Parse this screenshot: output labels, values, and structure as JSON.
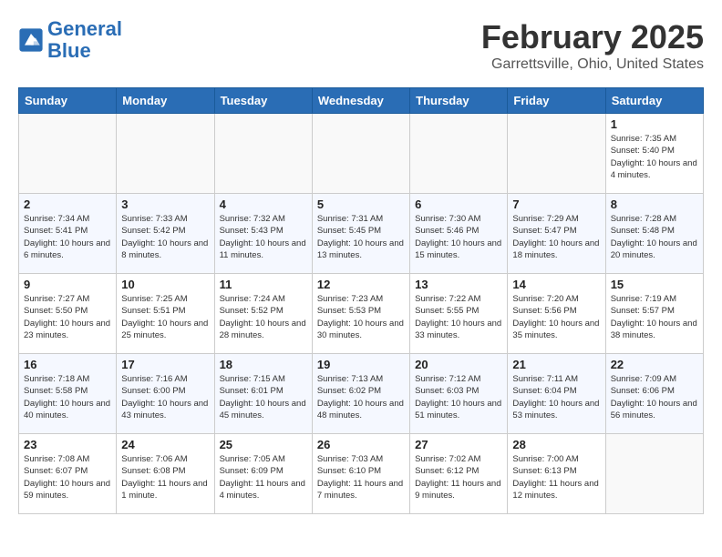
{
  "header": {
    "logo_line1": "General",
    "logo_line2": "Blue",
    "month_title": "February 2025",
    "subtitle": "Garrettsville, Ohio, United States"
  },
  "days_of_week": [
    "Sunday",
    "Monday",
    "Tuesday",
    "Wednesday",
    "Thursday",
    "Friday",
    "Saturday"
  ],
  "weeks": [
    [
      {
        "num": "",
        "info": "",
        "empty": true
      },
      {
        "num": "",
        "info": "",
        "empty": true
      },
      {
        "num": "",
        "info": "",
        "empty": true
      },
      {
        "num": "",
        "info": "",
        "empty": true
      },
      {
        "num": "",
        "info": "",
        "empty": true
      },
      {
        "num": "",
        "info": "",
        "empty": true
      },
      {
        "num": "1",
        "info": "Sunrise: 7:35 AM\nSunset: 5:40 PM\nDaylight: 10 hours\nand 4 minutes.",
        "empty": false
      }
    ],
    [
      {
        "num": "2",
        "info": "Sunrise: 7:34 AM\nSunset: 5:41 PM\nDaylight: 10 hours\nand 6 minutes.",
        "empty": false
      },
      {
        "num": "3",
        "info": "Sunrise: 7:33 AM\nSunset: 5:42 PM\nDaylight: 10 hours\nand 8 minutes.",
        "empty": false
      },
      {
        "num": "4",
        "info": "Sunrise: 7:32 AM\nSunset: 5:43 PM\nDaylight: 10 hours\nand 11 minutes.",
        "empty": false
      },
      {
        "num": "5",
        "info": "Sunrise: 7:31 AM\nSunset: 5:45 PM\nDaylight: 10 hours\nand 13 minutes.",
        "empty": false
      },
      {
        "num": "6",
        "info": "Sunrise: 7:30 AM\nSunset: 5:46 PM\nDaylight: 10 hours\nand 15 minutes.",
        "empty": false
      },
      {
        "num": "7",
        "info": "Sunrise: 7:29 AM\nSunset: 5:47 PM\nDaylight: 10 hours\nand 18 minutes.",
        "empty": false
      },
      {
        "num": "8",
        "info": "Sunrise: 7:28 AM\nSunset: 5:48 PM\nDaylight: 10 hours\nand 20 minutes.",
        "empty": false
      }
    ],
    [
      {
        "num": "9",
        "info": "Sunrise: 7:27 AM\nSunset: 5:50 PM\nDaylight: 10 hours\nand 23 minutes.",
        "empty": false
      },
      {
        "num": "10",
        "info": "Sunrise: 7:25 AM\nSunset: 5:51 PM\nDaylight: 10 hours\nand 25 minutes.",
        "empty": false
      },
      {
        "num": "11",
        "info": "Sunrise: 7:24 AM\nSunset: 5:52 PM\nDaylight: 10 hours\nand 28 minutes.",
        "empty": false
      },
      {
        "num": "12",
        "info": "Sunrise: 7:23 AM\nSunset: 5:53 PM\nDaylight: 10 hours\nand 30 minutes.",
        "empty": false
      },
      {
        "num": "13",
        "info": "Sunrise: 7:22 AM\nSunset: 5:55 PM\nDaylight: 10 hours\nand 33 minutes.",
        "empty": false
      },
      {
        "num": "14",
        "info": "Sunrise: 7:20 AM\nSunset: 5:56 PM\nDaylight: 10 hours\nand 35 minutes.",
        "empty": false
      },
      {
        "num": "15",
        "info": "Sunrise: 7:19 AM\nSunset: 5:57 PM\nDaylight: 10 hours\nand 38 minutes.",
        "empty": false
      }
    ],
    [
      {
        "num": "16",
        "info": "Sunrise: 7:18 AM\nSunset: 5:58 PM\nDaylight: 10 hours\nand 40 minutes.",
        "empty": false
      },
      {
        "num": "17",
        "info": "Sunrise: 7:16 AM\nSunset: 6:00 PM\nDaylight: 10 hours\nand 43 minutes.",
        "empty": false
      },
      {
        "num": "18",
        "info": "Sunrise: 7:15 AM\nSunset: 6:01 PM\nDaylight: 10 hours\nand 45 minutes.",
        "empty": false
      },
      {
        "num": "19",
        "info": "Sunrise: 7:13 AM\nSunset: 6:02 PM\nDaylight: 10 hours\nand 48 minutes.",
        "empty": false
      },
      {
        "num": "20",
        "info": "Sunrise: 7:12 AM\nSunset: 6:03 PM\nDaylight: 10 hours\nand 51 minutes.",
        "empty": false
      },
      {
        "num": "21",
        "info": "Sunrise: 7:11 AM\nSunset: 6:04 PM\nDaylight: 10 hours\nand 53 minutes.",
        "empty": false
      },
      {
        "num": "22",
        "info": "Sunrise: 7:09 AM\nSunset: 6:06 PM\nDaylight: 10 hours\nand 56 minutes.",
        "empty": false
      }
    ],
    [
      {
        "num": "23",
        "info": "Sunrise: 7:08 AM\nSunset: 6:07 PM\nDaylight: 10 hours\nand 59 minutes.",
        "empty": false
      },
      {
        "num": "24",
        "info": "Sunrise: 7:06 AM\nSunset: 6:08 PM\nDaylight: 11 hours\nand 1 minute.",
        "empty": false
      },
      {
        "num": "25",
        "info": "Sunrise: 7:05 AM\nSunset: 6:09 PM\nDaylight: 11 hours\nand 4 minutes.",
        "empty": false
      },
      {
        "num": "26",
        "info": "Sunrise: 7:03 AM\nSunset: 6:10 PM\nDaylight: 11 hours\nand 7 minutes.",
        "empty": false
      },
      {
        "num": "27",
        "info": "Sunrise: 7:02 AM\nSunset: 6:12 PM\nDaylight: 11 hours\nand 9 minutes.",
        "empty": false
      },
      {
        "num": "28",
        "info": "Sunrise: 7:00 AM\nSunset: 6:13 PM\nDaylight: 11 hours\nand 12 minutes.",
        "empty": false
      },
      {
        "num": "",
        "info": "",
        "empty": true
      }
    ]
  ]
}
